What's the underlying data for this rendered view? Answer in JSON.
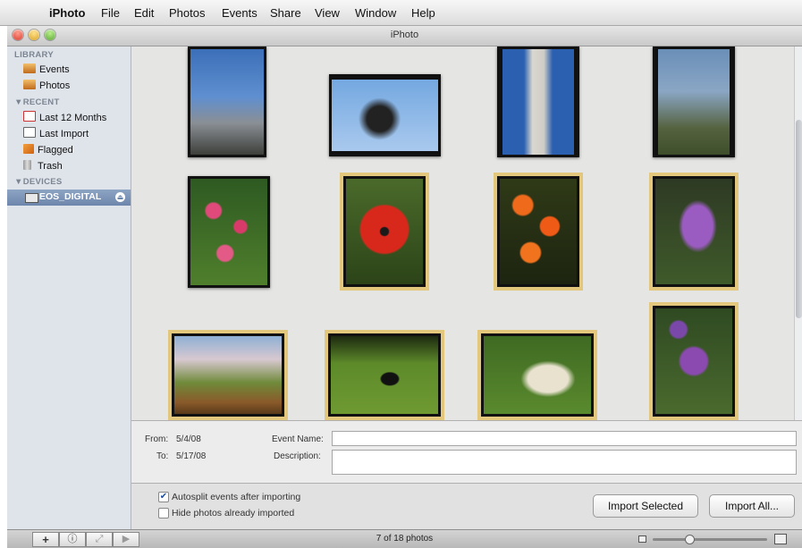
{
  "menubar": {
    "app": "iPhoto",
    "items": [
      "File",
      "Edit",
      "Photos",
      "Events",
      "Share",
      "View",
      "Window",
      "Help"
    ]
  },
  "window": {
    "title": "iPhoto"
  },
  "sidebar": {
    "library_heading": "LIBRARY",
    "library_items": [
      "Events",
      "Photos"
    ],
    "recent_heading": "▼RECENT",
    "recent_items": [
      "Last 12 Months",
      "Last Import",
      "Flagged",
      "Trash"
    ],
    "devices_heading": "▼DEVICES",
    "device_name": "EOS_DIGITAL"
  },
  "info": {
    "from_label": "From:",
    "from_value": "5/4/08",
    "to_label": "To:",
    "to_value": "5/17/08",
    "event_name_label": "Event Name:",
    "event_name_value": "",
    "description_label": "Description:",
    "description_value": ""
  },
  "import": {
    "autosplit_label": "Autosplit events after importing",
    "autosplit_checked": true,
    "hide_label": "Hide photos already imported",
    "hide_checked": false,
    "import_selected_label": "Import Selected",
    "import_all_label": "Import All..."
  },
  "status": {
    "photo_count": "7 of 18 photos"
  },
  "colors": {
    "selection_outline": "#e2c77c",
    "sidebar_bg": "#dfe4eb",
    "device_highlight": "#6d86ab"
  },
  "photos": [
    {
      "subject": "city-tower-monument",
      "selected": false
    },
    {
      "subject": "fountain-sculpture-sky",
      "selected": false
    },
    {
      "subject": "monument-spire",
      "selected": false
    },
    {
      "subject": "city-street-lamp",
      "selected": false
    },
    {
      "subject": "pink-tulips",
      "selected": false
    },
    {
      "subject": "red-tulip-closeup",
      "selected": true
    },
    {
      "subject": "orange-tulips",
      "selected": true
    },
    {
      "subject": "purple-lilac",
      "selected": true
    },
    {
      "subject": "garden-bridge",
      "selected": true
    },
    {
      "subject": "dog-shadow-lawn",
      "selected": true
    },
    {
      "subject": "white-dog",
      "selected": true
    },
    {
      "subject": "purple-allium",
      "selected": true
    }
  ]
}
